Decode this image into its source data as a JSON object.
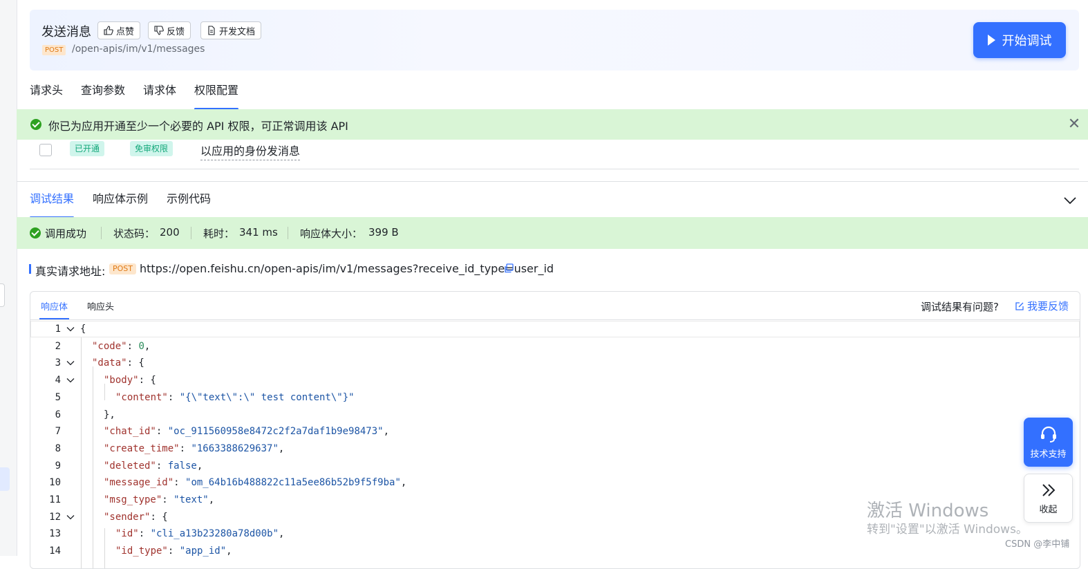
{
  "header": {
    "title": "发送消息",
    "like_label": "点赞",
    "feedback_label": "反馈",
    "docs_label": "开发文档",
    "method": "POST",
    "path": "/open-apis/im/v1/messages",
    "start_label": "开始调试"
  },
  "tabs": [
    "请求头",
    "查询参数",
    "请求体",
    "权限配置"
  ],
  "active_tab": "权限配置",
  "permission": {
    "banner_text": "你已为应用开通至少一个必要的 API 权限，可正常调用该 API",
    "status_tag": "已开通",
    "type_tag": "免审权限",
    "name": "以应用的身份发消息"
  },
  "result_tabs": [
    "调试结果",
    "响应体示例",
    "示例代码"
  ],
  "active_result_tab": "调试结果",
  "status_bar": {
    "success": "调用成功",
    "status_code_label": "状态码：",
    "status_code": "200",
    "time_label": "耗时：",
    "time": "341 ms",
    "size_label": "响应体大小：",
    "size": "399 B"
  },
  "request": {
    "label": "真实请求地址:",
    "method": "POST",
    "url": "https://open.feishu.cn/open-apis/im/v1/messages?receive_id_type=user_id"
  },
  "response": {
    "tabs": [
      "响应体",
      "响应头"
    ],
    "active_tab": "响应体",
    "question": "调试结果有问题?",
    "feedback_link": "我要反馈",
    "lines": [
      {
        "num": "1",
        "fold": true,
        "indent": 0,
        "parts": [
          {
            "t": "{",
            "c": "p"
          }
        ]
      },
      {
        "num": "2",
        "fold": false,
        "indent": 1,
        "parts": [
          {
            "t": "\"code\"",
            "c": "k"
          },
          {
            "t": ": ",
            "c": "p"
          },
          {
            "t": "0",
            "c": "n"
          },
          {
            "t": ",",
            "c": "p"
          }
        ]
      },
      {
        "num": "3",
        "fold": true,
        "indent": 1,
        "parts": [
          {
            "t": "\"data\"",
            "c": "k"
          },
          {
            "t": ": {",
            "c": "p"
          }
        ]
      },
      {
        "num": "4",
        "fold": true,
        "indent": 2,
        "parts": [
          {
            "t": "\"body\"",
            "c": "k"
          },
          {
            "t": ": {",
            "c": "p"
          }
        ]
      },
      {
        "num": "5",
        "fold": false,
        "indent": 3,
        "parts": [
          {
            "t": "\"content\"",
            "c": "k"
          },
          {
            "t": ": ",
            "c": "p"
          },
          {
            "t": "\"{\\\"text\\\":\\\" test content\\\"}\"",
            "c": "s"
          }
        ]
      },
      {
        "num": "6",
        "fold": false,
        "indent": 2,
        "parts": [
          {
            "t": "},",
            "c": "p"
          }
        ]
      },
      {
        "num": "7",
        "fold": false,
        "indent": 2,
        "parts": [
          {
            "t": "\"chat_id\"",
            "c": "k"
          },
          {
            "t": ": ",
            "c": "p"
          },
          {
            "t": "\"oc_911560958e8472c2f2a7daf1b9e98473\"",
            "c": "s"
          },
          {
            "t": ",",
            "c": "p"
          }
        ]
      },
      {
        "num": "8",
        "fold": false,
        "indent": 2,
        "parts": [
          {
            "t": "\"create_time\"",
            "c": "k"
          },
          {
            "t": ": ",
            "c": "p"
          },
          {
            "t": "\"1663388629637\"",
            "c": "s"
          },
          {
            "t": ",",
            "c": "p"
          }
        ]
      },
      {
        "num": "9",
        "fold": false,
        "indent": 2,
        "parts": [
          {
            "t": "\"deleted\"",
            "c": "k"
          },
          {
            "t": ": ",
            "c": "p"
          },
          {
            "t": "false",
            "c": "b"
          },
          {
            "t": ",",
            "c": "p"
          }
        ]
      },
      {
        "num": "10",
        "fold": false,
        "indent": 2,
        "parts": [
          {
            "t": "\"message_id\"",
            "c": "k"
          },
          {
            "t": ": ",
            "c": "p"
          },
          {
            "t": "\"om_64b16b488822c11a5ee86b52b9f5f9ba\"",
            "c": "s"
          },
          {
            "t": ",",
            "c": "p"
          }
        ]
      },
      {
        "num": "11",
        "fold": false,
        "indent": 2,
        "parts": [
          {
            "t": "\"msg_type\"",
            "c": "k"
          },
          {
            "t": ": ",
            "c": "p"
          },
          {
            "t": "\"text\"",
            "c": "s"
          },
          {
            "t": ",",
            "c": "p"
          }
        ]
      },
      {
        "num": "12",
        "fold": true,
        "indent": 2,
        "parts": [
          {
            "t": "\"sender\"",
            "c": "k"
          },
          {
            "t": ": {",
            "c": "p"
          }
        ]
      },
      {
        "num": "13",
        "fold": false,
        "indent": 3,
        "parts": [
          {
            "t": "\"id\"",
            "c": "k"
          },
          {
            "t": ": ",
            "c": "p"
          },
          {
            "t": "\"cli_a13b23280a78d00b\"",
            "c": "s"
          },
          {
            "t": ",",
            "c": "p"
          }
        ]
      },
      {
        "num": "14",
        "fold": false,
        "indent": 3,
        "parts": [
          {
            "t": "\"id_type\"",
            "c": "k"
          },
          {
            "t": ": ",
            "c": "p"
          },
          {
            "t": "\"app_id\"",
            "c": "s"
          },
          {
            "t": ",",
            "c": "p"
          }
        ]
      }
    ]
  },
  "float": {
    "support_label": "技术支持",
    "collapse_label": "收起"
  },
  "watermark": {
    "line1": "激活 Windows",
    "line2": "转到\"设置\"以激活 Windows。",
    "credit": "CSDN @李中铺"
  },
  "colors": {
    "accent": "#3370ff",
    "success_bg": "#d9f5d6",
    "success_icon": "#2ea121",
    "post_badge_bg": "#fde6cc",
    "post_badge_fg": "#e07a16"
  }
}
